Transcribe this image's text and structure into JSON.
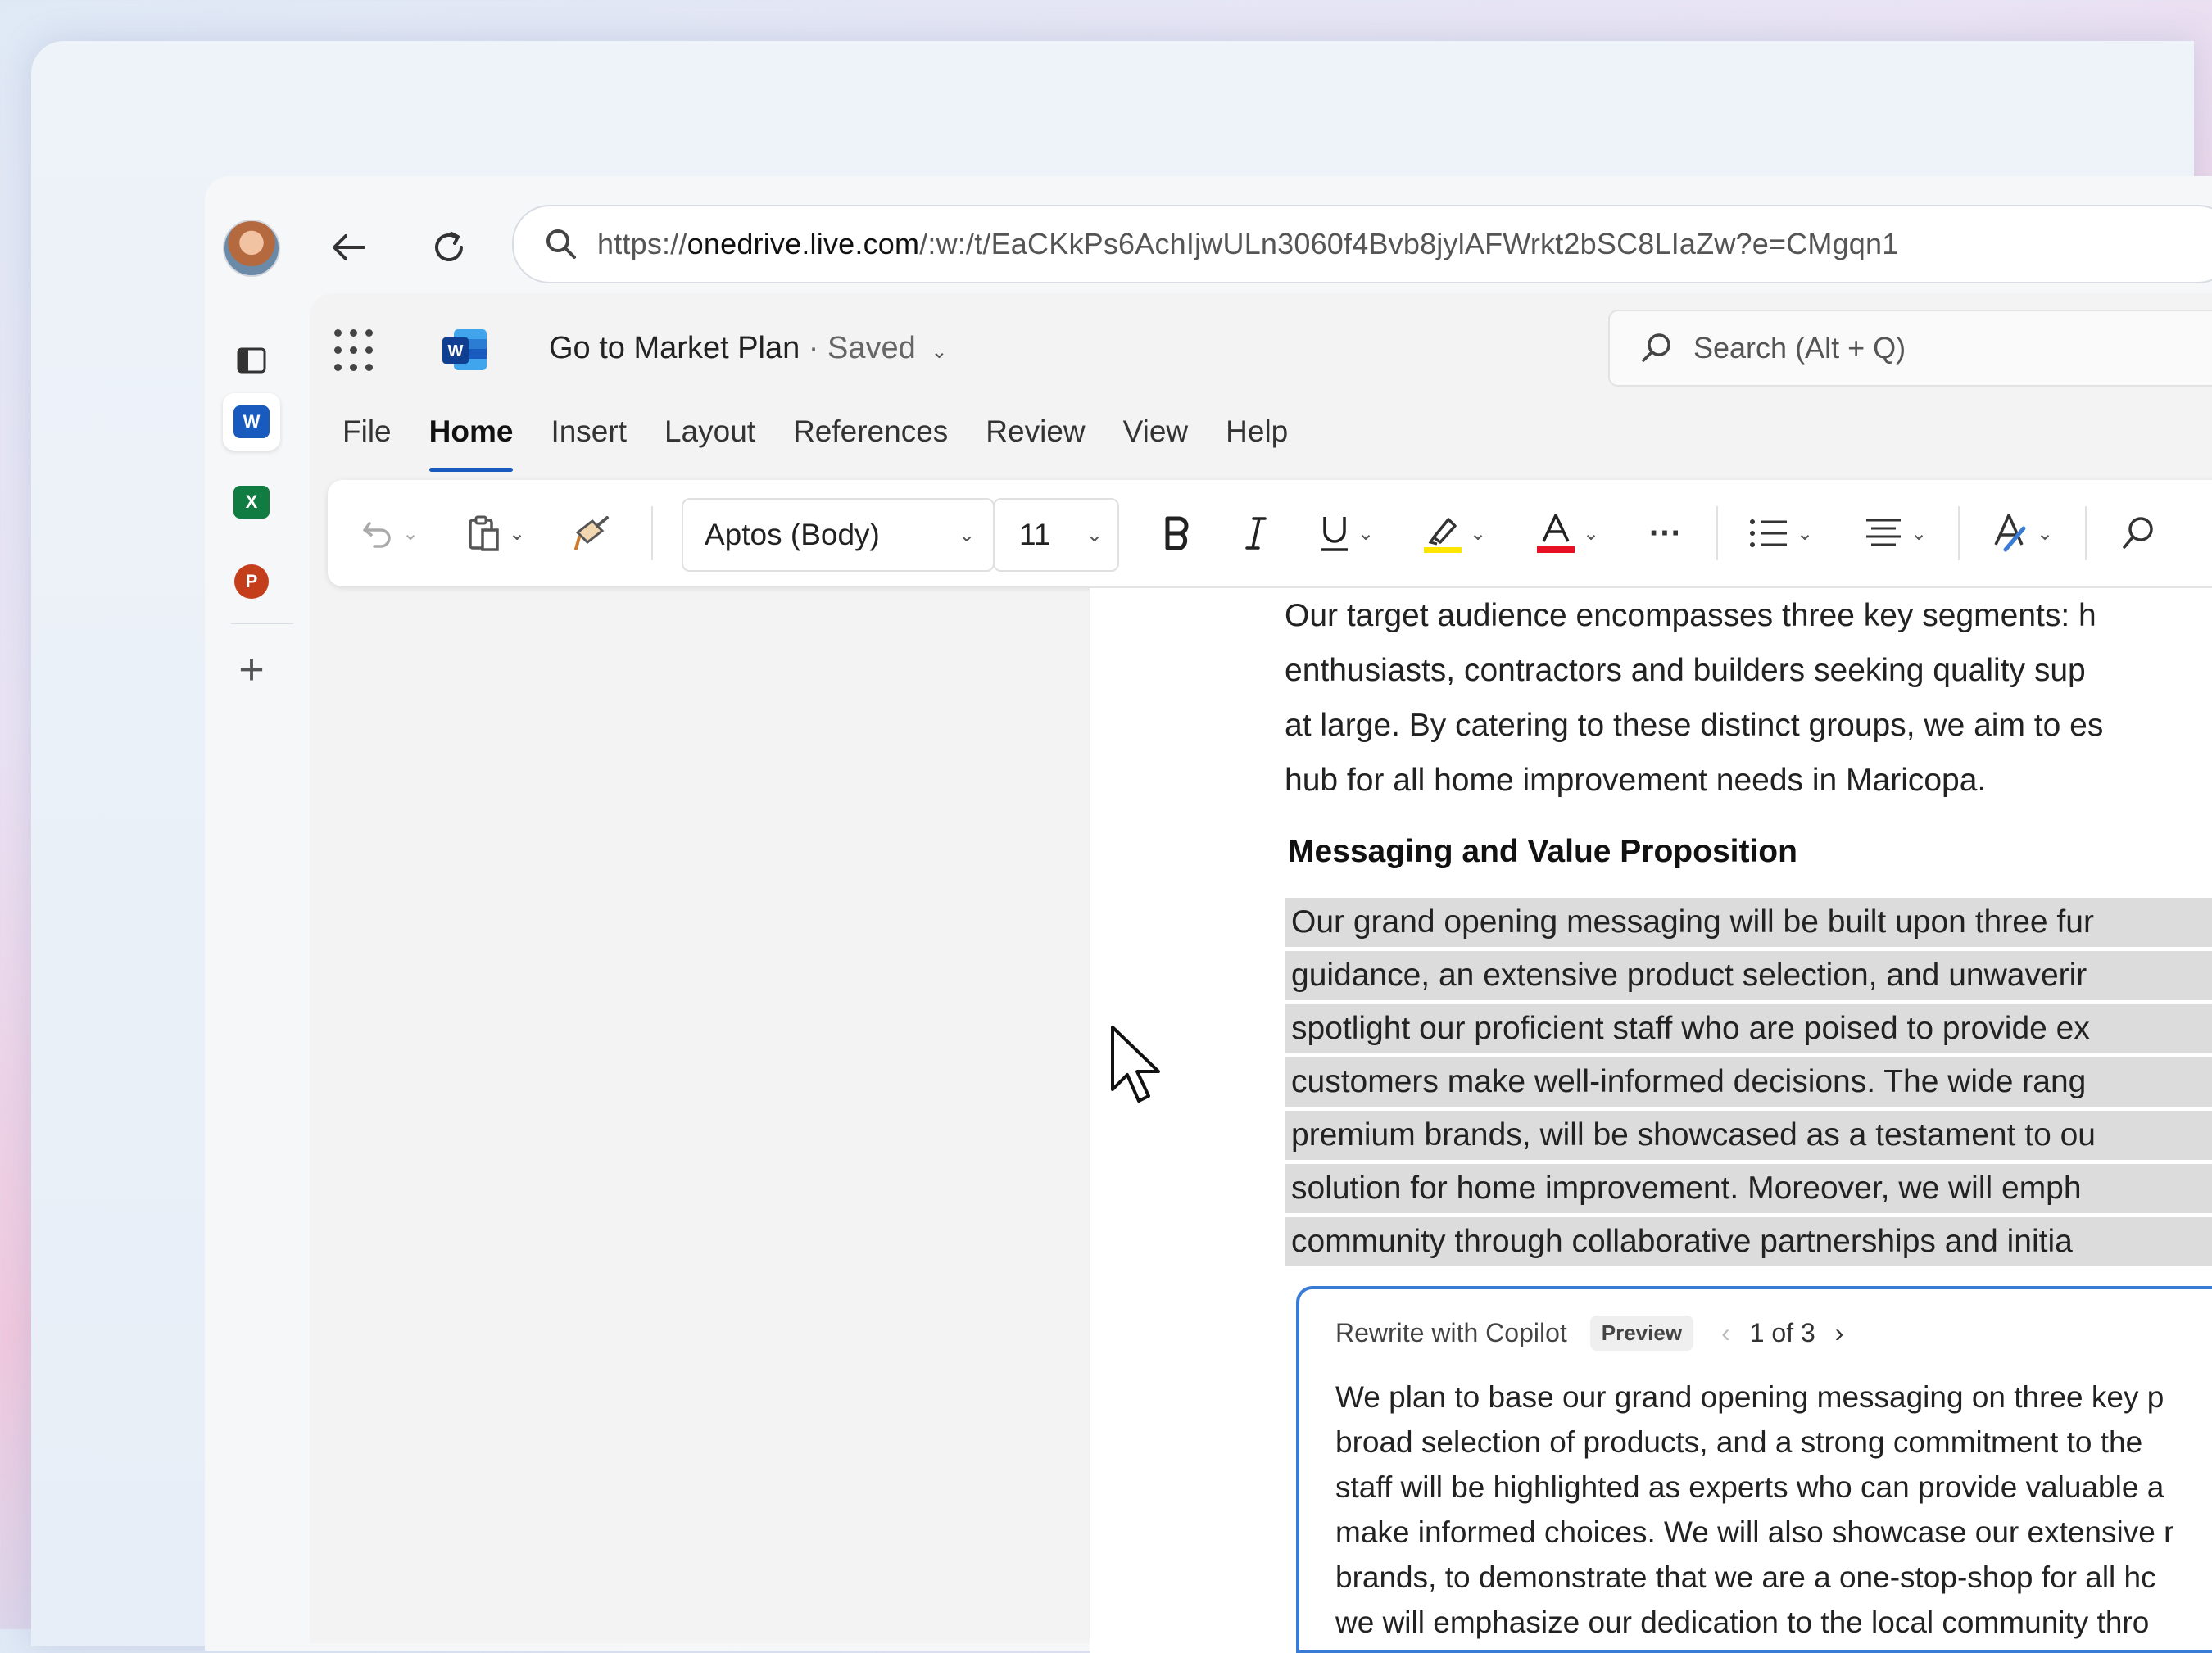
{
  "browser": {
    "url": "https://onedrive.live.com/:w:/t/EaCKkPs6AchIjwULn3060f4Bvb8jylAFWrkt2bSC8LIaZw?e=CMgqn1",
    "url_prefix": "https://",
    "url_domain": "onedrive.live.com",
    "url_path": "/:w:/t/EaCKkPs6AchIjwULn3060f4Bvb8jylAFWrkt2bSC8LIaZw?e=CMgqn1"
  },
  "rail": {
    "icons": [
      "tab-icon",
      "word-icon",
      "excel-icon",
      "powerpoint-icon",
      "add-icon"
    ],
    "word_letter": "W",
    "excel_letter": "X",
    "powerpoint_letter": "P",
    "add_symbol": "+"
  },
  "word": {
    "doc_title": "Go to Market Plan",
    "separator": " · ",
    "save_status": "Saved",
    "search_placeholder": "Search (Alt + Q)",
    "tabs": [
      "File",
      "Home",
      "Insert",
      "Layout",
      "References",
      "Review",
      "View",
      "Help"
    ],
    "active_tab": "Home",
    "font_name": "Aptos (Body)",
    "font_size": "11",
    "more_symbol": "···"
  },
  "document": {
    "intro_lines": [
      "Our target audience encompasses three key segments: h",
      "enthusiasts, contractors and builders seeking quality sup",
      "at large. By catering to these distinct groups, we aim to es",
      "hub for all home improvement needs in Maricopa."
    ],
    "heading": "Messaging and Value Proposition",
    "selected_lines": [
      "Our grand opening messaging will be built upon three fur",
      "guidance, an extensive product selection, and unwaverir",
      "spotlight our proficient staff who are poised to provide ex",
      "customers make well-informed decisions. The wide rang",
      "premium brands, will be showcased as a testament to ou",
      "solution for home improvement. Moreover, we will emph",
      "community through collaborative partnerships and initia"
    ]
  },
  "copilot": {
    "title": "Rewrite with Copilot",
    "badge": "Preview",
    "pager": "1 of 3",
    "lines": [
      "We plan to base our grand opening messaging on three key p",
      "broad selection of products, and a strong commitment to the",
      "staff will be highlighted as experts who can provide valuable a",
      "make informed choices. We will also showcase our extensive r",
      "brands, to demonstrate that we are a one-stop-shop for all hc",
      "we will emphasize our dedication to the local community thro"
    ]
  },
  "colors": {
    "word_blue": "#185abd",
    "excel_green": "#107c41",
    "powerpoint_red": "#c43e1c",
    "highlight_yellow": "#ffe600",
    "font_color_red": "#e81123",
    "copilot_border": "#3a7bd5"
  }
}
